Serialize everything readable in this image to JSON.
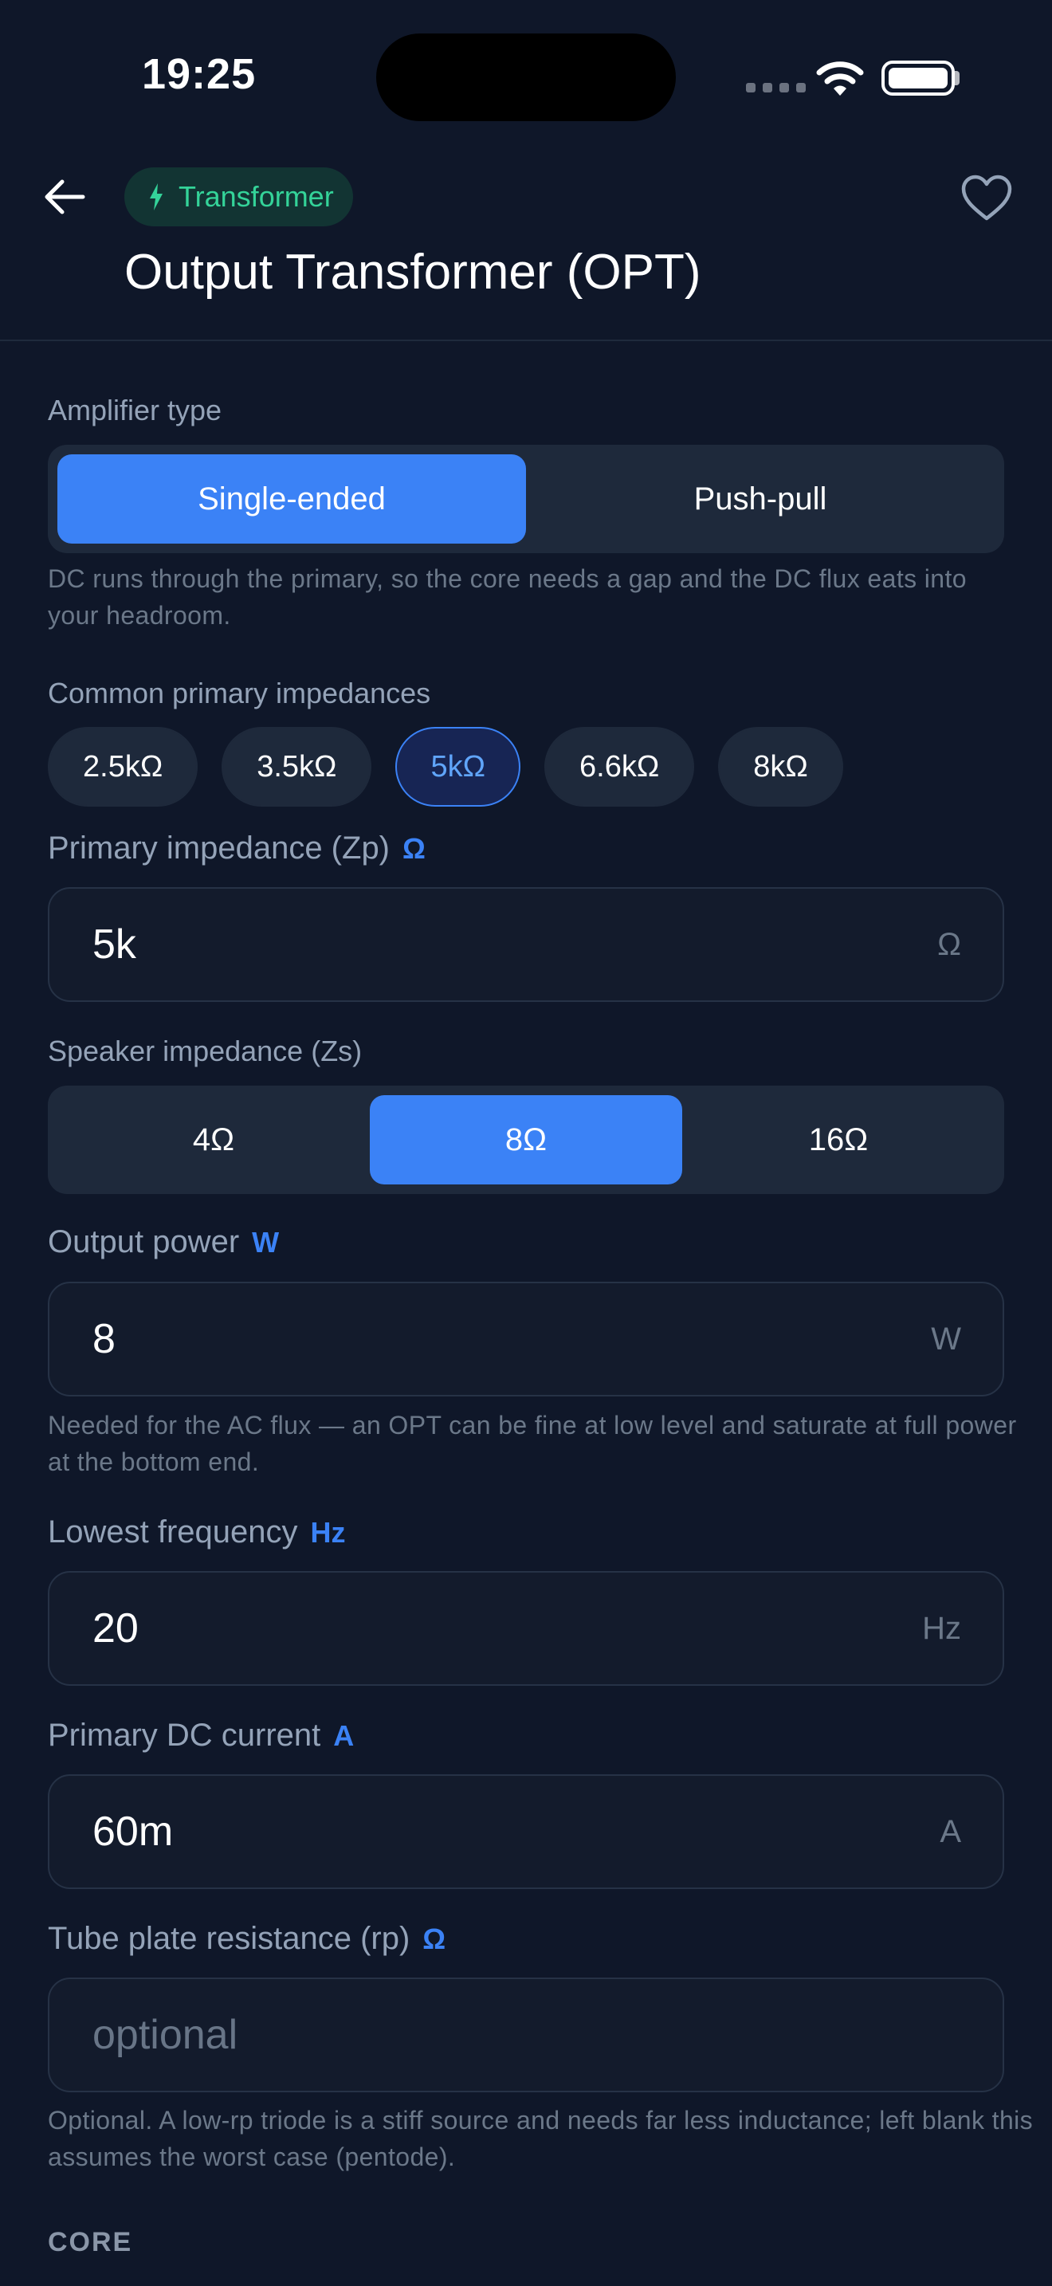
{
  "status_bar": {
    "time": "19:25"
  },
  "header": {
    "category_chip": "Transformer",
    "title": "Output Transformer (OPT)"
  },
  "amplifier_type": {
    "label": "Amplifier type",
    "options": [
      "Single-ended",
      "Push-pull"
    ],
    "selected": "Single-ended",
    "help": "DC runs through the primary, so the core needs a gap and the DC flux eats into your headroom."
  },
  "presets": {
    "label": "Common primary impedances",
    "items": [
      "2.5kΩ",
      "3.5kΩ",
      "5kΩ",
      "6.6kΩ",
      "8kΩ"
    ],
    "selected": "5kΩ"
  },
  "primary_impedance": {
    "label": "Primary impedance (Zp)",
    "unit_tag": "Ω",
    "value": "5k",
    "suffix": "Ω"
  },
  "speaker_impedance": {
    "label": "Speaker impedance (Zs)",
    "options": [
      "4Ω",
      "8Ω",
      "16Ω"
    ],
    "selected": "8Ω"
  },
  "output_power": {
    "label": "Output power",
    "unit_tag": "W",
    "value": "8",
    "suffix": "W",
    "help": "Needed for the AC flux — an OPT can be fine at low level and saturate at full power at the bottom end."
  },
  "lowest_frequency": {
    "label": "Lowest frequency",
    "unit_tag": "Hz",
    "value": "20",
    "suffix": "Hz"
  },
  "primary_dc_current": {
    "label": "Primary DC current",
    "unit_tag": "A",
    "value": "60m",
    "suffix": "A"
  },
  "plate_resistance": {
    "label": "Tube plate resistance (rp)",
    "unit_tag": "Ω",
    "placeholder": "optional",
    "help": "Optional. A low-rp triode is a stiff source and needs far less inductance; left blank this assumes the worst case (pentode)."
  },
  "core_section": {
    "heading": "CORE"
  },
  "colors": {
    "accent": "#3b82f6",
    "chip_text": "#34d399",
    "background": "#0f1729"
  }
}
